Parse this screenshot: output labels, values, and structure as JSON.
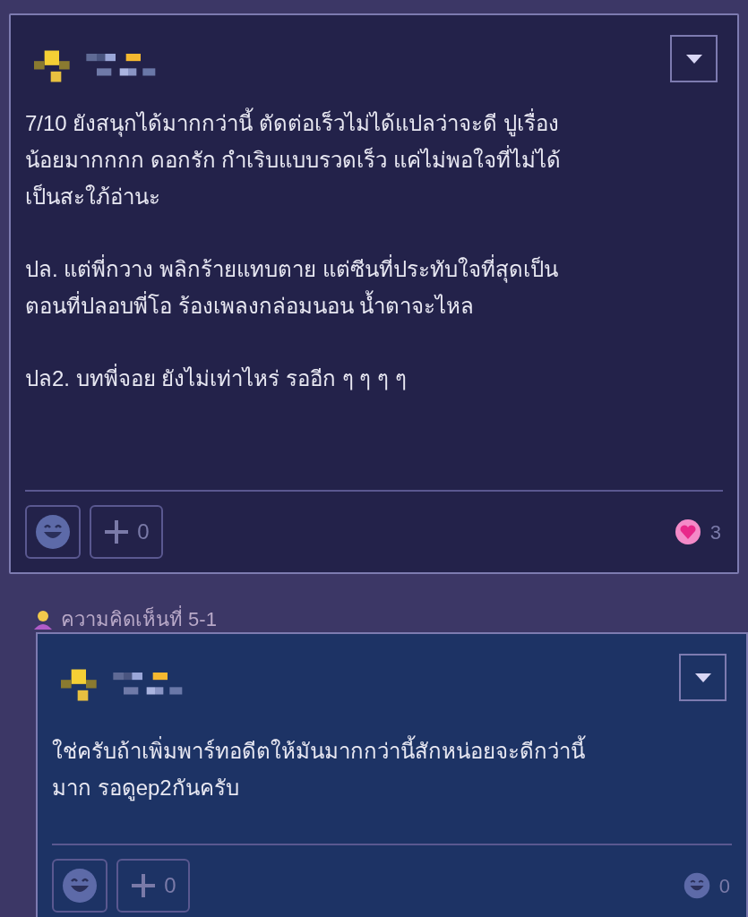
{
  "comments": [
    {
      "kind": "main",
      "paragraphs": [
        {
          "lines": [
            "7/10  ยังสนุกได้มากกว่านี้  ตัดต่อเร็วไม่ได้แปลว่าจะดี ปูเรื่อง",
            "น้อยมากกกก ดอกรัก กำเริบแบบรวดเร็ว แค่ไม่พอใจที่ไม่ได้",
            "เป็นสะใภ้อ่านะ"
          ]
        },
        {
          "lines": [
            "ปล. แต่พี่กวาง พลิกร้ายแทบตาย แต่ซีนที่ประทับใจที่สุดเป็น",
            "ตอนที่ปลอบพี่โอ ร้องเพลงกล่อมนอน น้ำตาจะไหล"
          ]
        },
        {
          "lines": [
            "ปล2. บทพี่จอย ยังไม่เท่าไหร่ รออีก ๆ ๆ ๆ ๆ"
          ]
        }
      ],
      "plus_count": "0",
      "reaction": {
        "kind": "love",
        "count": "3"
      }
    },
    {
      "kind": "reply",
      "label": "ความคิดเห็นที่ 5-1",
      "paragraphs": [
        {
          "lines": [
            "ใช่ครับถ้าเพิ่มพาร์ทอดีตให้มันมากกว่านี้สักหน่อยจะดีกว่านี้",
            "มาก รอดูep2กันครับ"
          ]
        }
      ],
      "plus_count": "0",
      "reaction": {
        "kind": "none",
        "count": "0"
      }
    }
  ]
}
